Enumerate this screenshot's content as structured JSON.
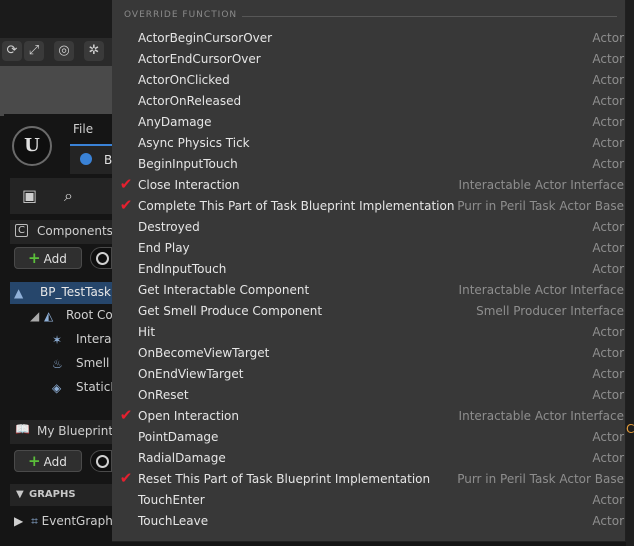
{
  "editor": {
    "menu_file": "File",
    "tab_label": "B",
    "logo_text": "U",
    "components_header": "Components",
    "add_label": "Add",
    "component_tree": [
      "BP_TestTask",
      "Root Co",
      "Interac",
      "Smell",
      "StaticM"
    ],
    "my_blueprint_header": "My Blueprint",
    "graphs_header": "GRAPHS",
    "event_graph": "EventGraph",
    "edge_text": "C"
  },
  "menu": {
    "header": "OVERRIDE FUNCTION",
    "check_glyph": "✔",
    "items": [
      {
        "name": "ActorBeginCursorOver",
        "category": "Actor",
        "checked": false
      },
      {
        "name": "ActorEndCursorOver",
        "category": "Actor",
        "checked": false
      },
      {
        "name": "ActorOnClicked",
        "category": "Actor",
        "checked": false
      },
      {
        "name": "ActorOnReleased",
        "category": "Actor",
        "checked": false
      },
      {
        "name": "AnyDamage",
        "category": "Actor",
        "checked": false
      },
      {
        "name": "Async Physics Tick",
        "category": "Actor",
        "checked": false
      },
      {
        "name": "BeginInputTouch",
        "category": "Actor",
        "checked": false
      },
      {
        "name": "Close Interaction",
        "category": "Interactable Actor Interface",
        "checked": true
      },
      {
        "name": "Complete This Part of Task Blueprint Implementation",
        "category": "Purr in Peril Task Actor Base",
        "checked": true
      },
      {
        "name": "Destroyed",
        "category": "Actor",
        "checked": false
      },
      {
        "name": "End Play",
        "category": "Actor",
        "checked": false
      },
      {
        "name": "EndInputTouch",
        "category": "Actor",
        "checked": false
      },
      {
        "name": "Get Interactable Component",
        "category": "Interactable Actor Interface",
        "checked": false
      },
      {
        "name": "Get Smell Produce Component",
        "category": "Smell Producer Interface",
        "checked": false
      },
      {
        "name": "Hit",
        "category": "Actor",
        "checked": false
      },
      {
        "name": "OnBecomeViewTarget",
        "category": "Actor",
        "checked": false
      },
      {
        "name": "OnEndViewTarget",
        "category": "Actor",
        "checked": false
      },
      {
        "name": "OnReset",
        "category": "Actor",
        "checked": false
      },
      {
        "name": "Open Interaction",
        "category": "Interactable Actor Interface",
        "checked": true
      },
      {
        "name": "PointDamage",
        "category": "Actor",
        "checked": false
      },
      {
        "name": "RadialDamage",
        "category": "Actor",
        "checked": false
      },
      {
        "name": "Reset This Part of Task Blueprint Implementation",
        "category": "Purr in Peril Task Actor Base",
        "checked": true
      },
      {
        "name": "TouchEnter",
        "category": "Actor",
        "checked": false
      },
      {
        "name": "TouchLeave",
        "category": "Actor",
        "checked": false
      }
    ]
  },
  "colors": {
    "menu_bg": "#383838",
    "check": "#e5202f",
    "selection": "#26466b",
    "accent": "#3a82d6"
  }
}
